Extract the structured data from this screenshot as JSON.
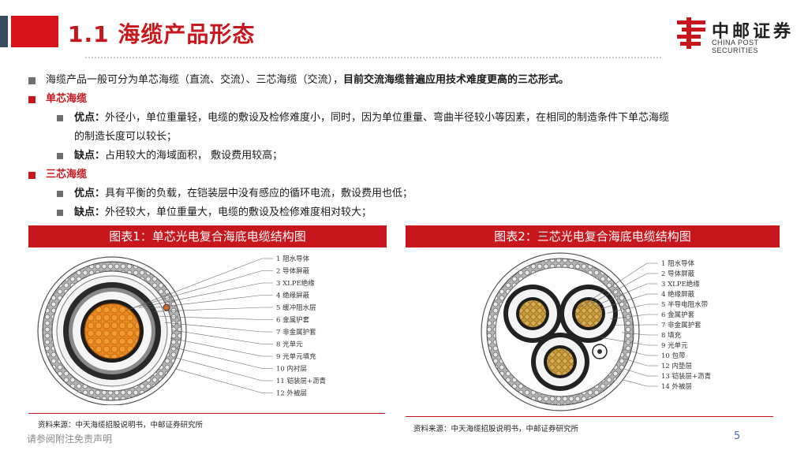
{
  "header": {
    "title": "1.1 海缆产品形态",
    "logo_cn": "中邮证券",
    "logo_en": "CHINA POST SECURITIES"
  },
  "bullets": {
    "intro_normal": "海缆产品一般可分为单芯海缆（直流、交流）、三芯海缆（交流），",
    "intro_bold": "目前交流海缆普遍应用技术难度更高的三芯形式。",
    "single": {
      "heading": "单芯海缆",
      "pros_label": "优点：",
      "pros_text": "外径小，单位重量轻，电缆的敷设及检修难度小，同时，因为单位重量、弯曲半径较小等因素，在相同的制造条件下单芯海缆",
      "pros_text_cont": "的制造长度可以较长；",
      "cons_label": "缺点：",
      "cons_text": "占用较大的海域面积， 敷设费用较高；"
    },
    "triple": {
      "heading": "三芯海缆",
      "pros_label": "优点：",
      "pros_text": "具有平衡的负载，在铠装层中没有感应的循环电流，敷设费用也低；",
      "cons_label": "缺点：",
      "cons_text": "外径较大，单位重量大，电缆的敷设及检修难度相对较大；"
    }
  },
  "figures": {
    "fig1_caption": "图表1：单芯光电复合海底电缆结构图",
    "fig2_caption": "图表2：三芯光电复合海底电缆结构图",
    "fig1_labels": [
      "1 阻水导体",
      "2 导体屏蔽",
      "3 XLPE绝缘",
      "4 绝缘屏蔽",
      "5 缓冲阻水层",
      "6 金属护套",
      "7 非金属护套",
      "8 光单元",
      "9 光单元填充",
      "10 内衬层",
      "11 铠装层+沥青",
      "12 外被层"
    ],
    "fig2_labels": [
      "1 阻水导体",
      "2 导体屏蔽",
      "3 XLPE绝缘",
      "4 绝缘屏蔽",
      "5 半导电阻水带",
      "6 金属护套",
      "7 非金属护套",
      "8 填充",
      "9 光单元",
      "10 包带",
      "12 内垫层",
      "13 铠装层+沥青",
      "14 外被层"
    ],
    "fig1_source": "资料来源：中天海缆招股说明书，中邮证券研究所",
    "fig2_source": "资料来源：中天海缆招股说明书，中邮证券研究所"
  },
  "footer": {
    "disclaimer": "请参阅附注免责声明",
    "page_number": "5"
  },
  "colors": {
    "brand_red": "#c8161d",
    "dark_bar": "#3b4a5c",
    "conductor_orange": "#e8871e",
    "conductor_gold": "#c99a3a"
  }
}
